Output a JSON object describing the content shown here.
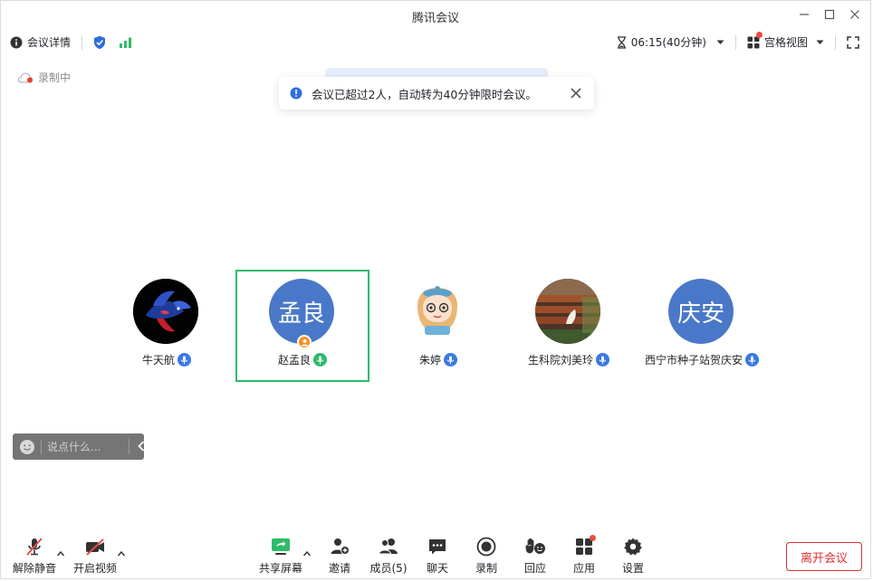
{
  "window": {
    "title": "腾讯会议"
  },
  "toolbar": {
    "meeting_details": "会议详情",
    "timer": "06:15(40分钟)",
    "view_mode": "宫格视图"
  },
  "recording_status": "录制中",
  "toast": {
    "message": "会议已超过2人，自动转为40分钟限时会议。"
  },
  "participants": [
    {
      "name": "牛天航",
      "avatar_type": "photo-fish"
    },
    {
      "name": "赵孟良",
      "avatar_text": "孟良",
      "active_speaker": true,
      "host": true
    },
    {
      "name": "朱婷",
      "avatar_type": "photo-cartoon-girl"
    },
    {
      "name": "生科院刘美玲",
      "avatar_type": "photo-bench"
    },
    {
      "name": "西宁市种子站贺庆安",
      "avatar_text": "庆安"
    }
  ],
  "chat": {
    "placeholder": "说点什么..."
  },
  "bottom_bar": {
    "unmute": "解除静音",
    "start_video": "开启视频",
    "share_screen": "共享屏幕",
    "invite": "邀请",
    "members": "成员(5)",
    "chat": "聊天",
    "record": "录制",
    "reactions": "回应",
    "apps": "应用",
    "settings": "设置",
    "leave": "离开会议"
  },
  "colors": {
    "accent_blue": "#3a78e6",
    "avatar_blue": "#4a78c8",
    "active_green": "#2ebb6a",
    "leave_red": "#e02f2f",
    "muted_red": "#e84a4a"
  }
}
